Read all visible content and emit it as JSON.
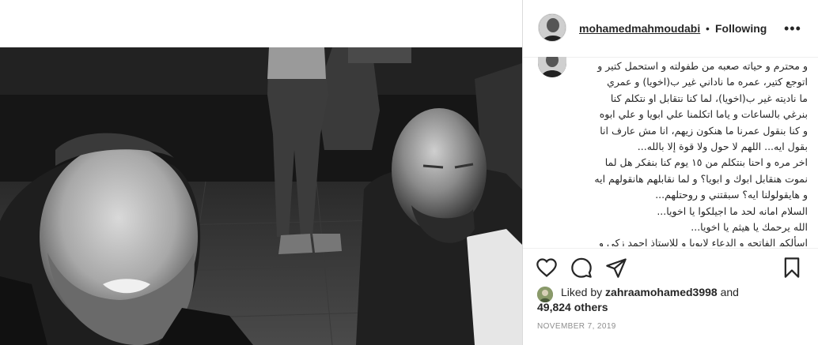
{
  "header": {
    "username": "mohamedmahmoudabi",
    "separator": "•",
    "follow_status": "Following",
    "more_label": "•••"
  },
  "caption_lines": [
    "و محترم و حياته صعبه من طفولته و استحمل كتير و",
    "اتوجع كتير، عمره ما ناداني غير ب(اخويا) و عمري",
    "ما ناديته غير ب(اخويا)، لما كنا نتقابل او نتكلم كنا",
    "بنرغي بالساعات و ياما اتكلمنا علي ابويا و علي ابوه",
    "و كنا بنقول عمرنا ما هنكون زيهم، انا مش عارف انا",
    "بقول ايه... اللهم لا حول ولا قوة إلا بالله...",
    "اخر مره و احنا بنتكلم من ١٥ يوم كنا بنفكر هل لما",
    "نموت هنقابل ابوك و ابويا؟ و لما نقابلهم هانقولهم ايه",
    "و هايقولولنا ايه؟ سبقتني و روحتلهم...",
    "السلام امانه لحد ما اجيلكوا يا اخويا...",
    "الله يرحمك يا هيثم يا اخويا...",
    "اسألكم الفاتحه و الدعاء لابويا و للاستاذ احمد زكي و"
  ],
  "actions": {
    "like_icon": "heart-icon",
    "comment_icon": "comment-icon",
    "share_icon": "share-icon",
    "save_icon": "bookmark-icon"
  },
  "likes": {
    "prefix": "Liked by ",
    "user": "zahraamohamed3998",
    "suffix": " and",
    "others": "49,824 others"
  },
  "date": "NOVEMBER 7, 2019"
}
